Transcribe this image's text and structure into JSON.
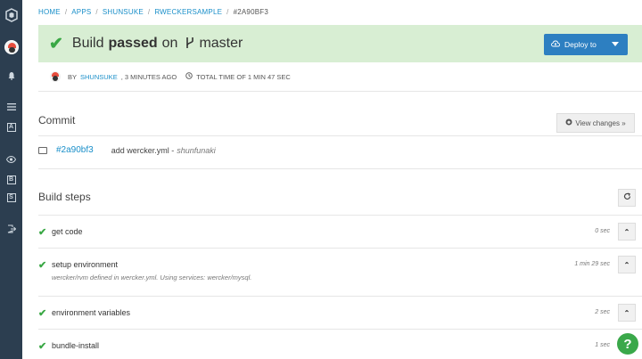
{
  "sidebar": {
    "icons": [
      "logo-icon",
      "avatar",
      "bell-icon",
      "menu-icon",
      "box-a-icon",
      "eye-icon",
      "box-b-icon",
      "box-s-icon",
      "exit-icon"
    ],
    "box_a": "A",
    "box_b": "B",
    "box_s": "S"
  },
  "breadcrumb": {
    "items": [
      "HOME",
      "APPS",
      "SHUNSUKE",
      "RWECKERSAMPLE"
    ],
    "separator": "/",
    "current": "#2A90BF3"
  },
  "banner": {
    "prefix": "Build",
    "status": "passed",
    "on": "on",
    "branch": "master",
    "deploy_label": "Deploy to",
    "status_color": "#3aa845"
  },
  "meta": {
    "by": "BY",
    "user": "SHUNSUKE",
    "ago": ", 3 MINUTES AGO",
    "total_time": "TOTAL TIME OF 1 MIN 47 SEC"
  },
  "commit": {
    "heading": "Commit",
    "view_changes": "View changes »",
    "hash": "#2a90bf3",
    "message": "add wercker.yml -",
    "author": "shunfunaki"
  },
  "build_steps": {
    "heading": "Build steps",
    "steps": [
      {
        "name": "get code",
        "duration": "0 sec",
        "description": ""
      },
      {
        "name": "setup environment",
        "duration": "1 min 29 sec",
        "description": "wercker/rvm defined in wercker.yml. Using services: wercker/mysql."
      },
      {
        "name": "environment variables",
        "duration": "2 sec",
        "description": ""
      },
      {
        "name": "bundle-install",
        "duration": "1 sec",
        "description": ""
      }
    ]
  },
  "help": {
    "label": "?"
  }
}
